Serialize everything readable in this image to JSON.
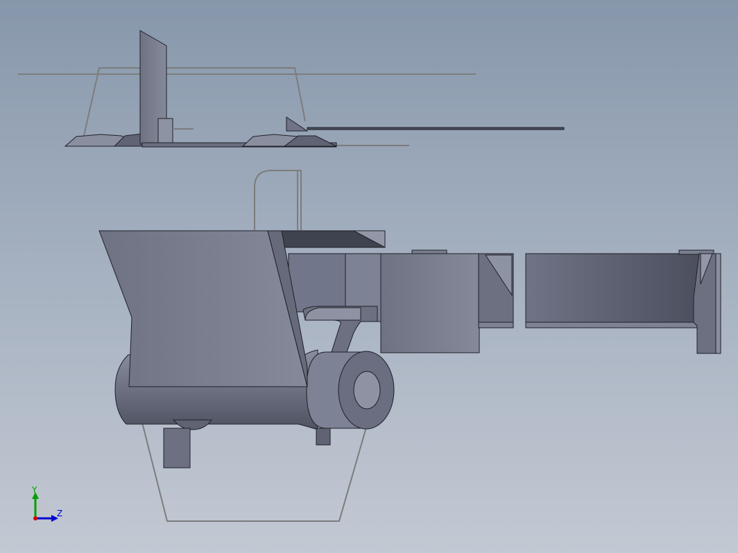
{
  "viewport": {
    "model_name": "",
    "colors": {
      "background_top": "#8797ab",
      "background_bottom": "#c3c9d3",
      "part_face": "#7a7f90",
      "part_edge": "#1e1f26",
      "sketch_line": "#7c7c7c"
    }
  },
  "triad": {
    "y_label": "Y",
    "z_label": "Z",
    "y_color": "#00a000",
    "z_color": "#0000d0",
    "x_color": "#d00000"
  }
}
